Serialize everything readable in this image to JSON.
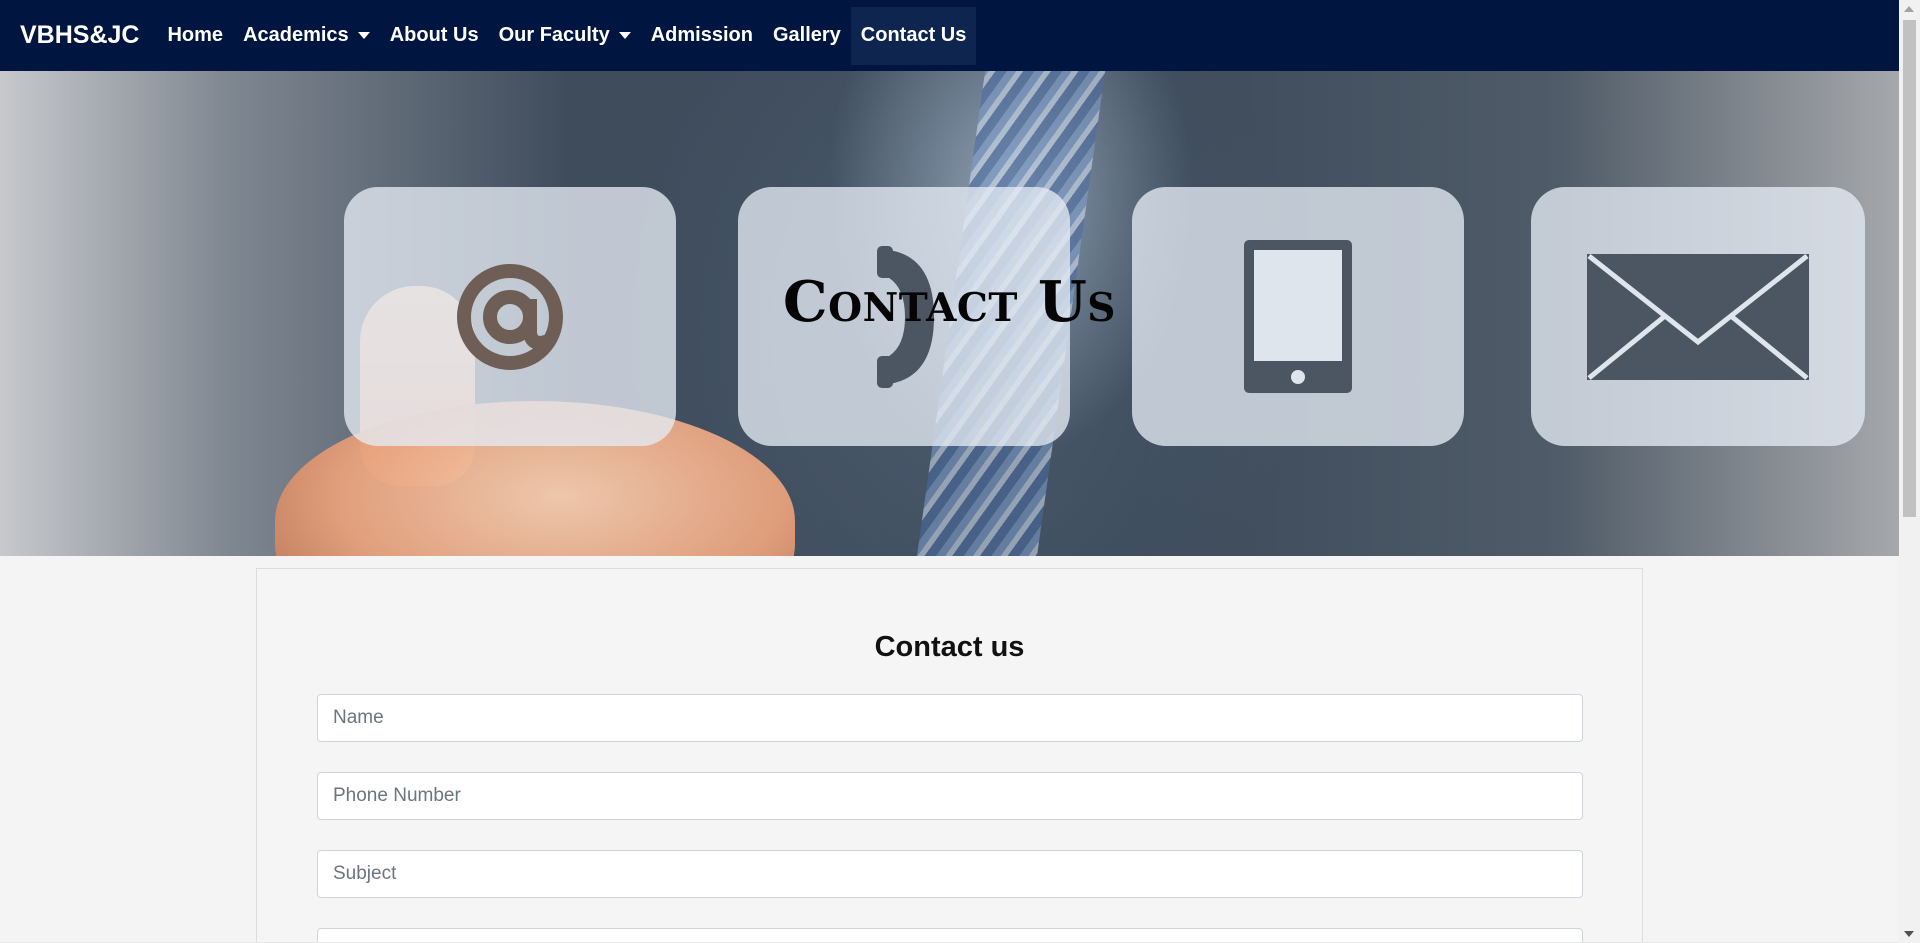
{
  "navbar": {
    "brand": "VBHS&JC",
    "items": [
      {
        "label": "Home",
        "dropdown": false,
        "active": false
      },
      {
        "label": "Academics",
        "dropdown": true,
        "active": false
      },
      {
        "label": "About Us",
        "dropdown": false,
        "active": false
      },
      {
        "label": "Our Faculty",
        "dropdown": true,
        "active": false
      },
      {
        "label": "Admission",
        "dropdown": false,
        "active": false
      },
      {
        "label": "Gallery",
        "dropdown": false,
        "active": false
      },
      {
        "label": "Contact Us",
        "dropdown": false,
        "active": true
      }
    ]
  },
  "hero": {
    "title": "Contact Us",
    "icons": [
      "at-sign-icon",
      "telephone-icon",
      "smartphone-icon",
      "envelope-icon"
    ]
  },
  "form": {
    "title": "Contact us",
    "name_placeholder": "Name",
    "phone_placeholder": "Phone Number",
    "subject_placeholder": "Subject"
  },
  "colors": {
    "navbar_bg": "#001640",
    "active_nav_bg": "#0e2550",
    "page_bg": "#f4f4f4"
  }
}
